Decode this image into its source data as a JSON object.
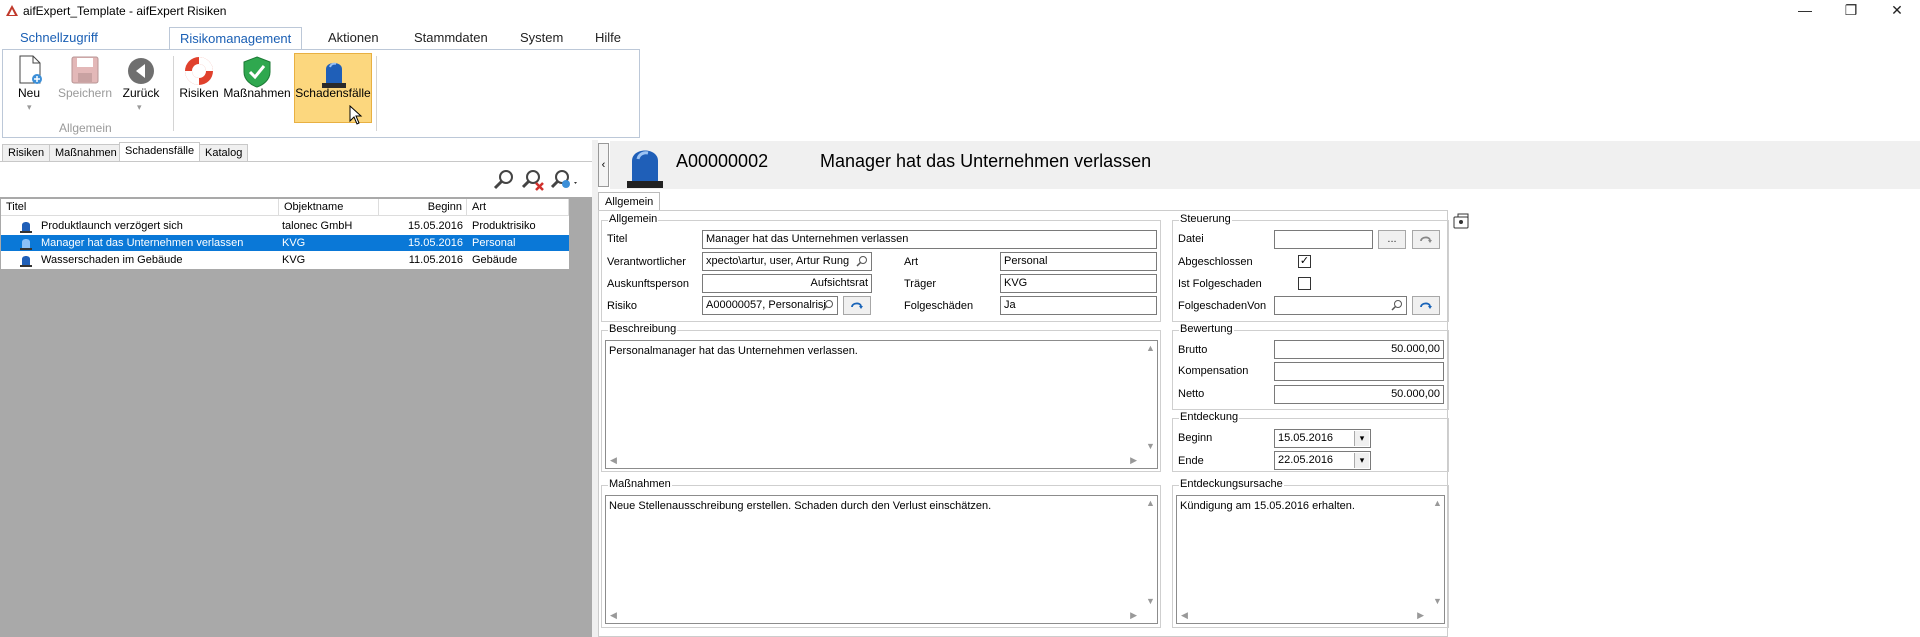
{
  "window": {
    "title": "aifExpert_Template - aifExpert Risiken",
    "minimize": "—",
    "restore": "❐",
    "close": "✕"
  },
  "ribbon": {
    "tabs": [
      "Schnellzugriff",
      "Risikomanagement",
      "Aktionen",
      "Stammdaten",
      "System",
      "Hilfe"
    ],
    "buttons": {
      "neu": "Neu",
      "speichern": "Speichern",
      "zurueck": "Zurück",
      "risiken": "Risiken",
      "massnahmen": "Maßnahmen",
      "schadensfaelle": "Schadensfälle"
    },
    "group_label": "Allgemein"
  },
  "left": {
    "tabs": [
      "Risiken",
      "Maßnahmen",
      "Schadensfälle",
      "Katalog"
    ],
    "columns": [
      "Titel",
      "Objektname",
      "Beginn",
      "Art"
    ],
    "rows": [
      {
        "titel": "Produktlaunch verzögert sich",
        "objektname": "talonec GmbH",
        "beginn": "15.05.2016",
        "art": "Produktrisiko"
      },
      {
        "titel": "Manager hat das Unternehmen verlassen",
        "objektname": "KVG",
        "beginn": "15.05.2016",
        "art": "Personal"
      },
      {
        "titel": "Wasserschaden im Gebäude",
        "objektname": "KVG",
        "beginn": "11.05.2016",
        "art": "Gebäude"
      }
    ]
  },
  "detail": {
    "id": "A00000002",
    "title": "Manager hat das Unternehmen verlassen",
    "tab": "Allgemein",
    "allgemein": {
      "group": "Allgemein",
      "titel_label": "Titel",
      "titel": "Manager hat das Unternehmen verlassen",
      "verantwortlicher_label": "Verantwortlicher",
      "verantwortlicher": "xpecto\\artur, user, Artur Rung",
      "auskunftsperson_label": "Auskunftsperson",
      "auskunftsperson": "Aufsichtsrat",
      "risiko_label": "Risiko",
      "risiko": "A00000057, Personalrisi",
      "art_label": "Art",
      "art": "Personal",
      "traeger_label": "Träger",
      "traeger": "KVG",
      "folgeschaeden_label": "Folgeschäden",
      "folgeschaeden": "Ja"
    },
    "steuerung": {
      "group": "Steuerung",
      "datei_label": "Datei",
      "datei": "",
      "datei_btn": "...",
      "abgeschlossen_label": "Abgeschlossen",
      "abgeschlossen": "✓",
      "folgeschaden_label": "Ist Folgeschaden",
      "folgeschaden": "",
      "folgeschadenvon_label": "FolgeschadenVon",
      "folgeschadenvon": ""
    },
    "beschreibung": {
      "group": "Beschreibung",
      "text": "Personalmanager hat das Unternehmen verlassen."
    },
    "bewertung": {
      "group": "Bewertung",
      "brutto_label": "Brutto",
      "brutto": "50.000,00",
      "kompensation_label": "Kompensation",
      "kompensation": "",
      "netto_label": "Netto",
      "netto": "50.000,00"
    },
    "entdeckung": {
      "group": "Entdeckung",
      "beginn_label": "Beginn",
      "beginn": "15.05.2016",
      "ende_label": "Ende",
      "ende": "22.05.2016"
    },
    "massnahmen": {
      "group": "Maßnahmen",
      "text": "Neue Stellenausschreibung erstellen. Schaden durch den Verlust einschätzen."
    },
    "entdeckungsursache": {
      "group": "Entdeckungsursache",
      "text": "Kündigung am 15.05.2016 erhalten."
    }
  },
  "colors": {
    "accent": "#1a5fb4",
    "selection": "#0a78d7",
    "hot": "#fcd77e"
  }
}
